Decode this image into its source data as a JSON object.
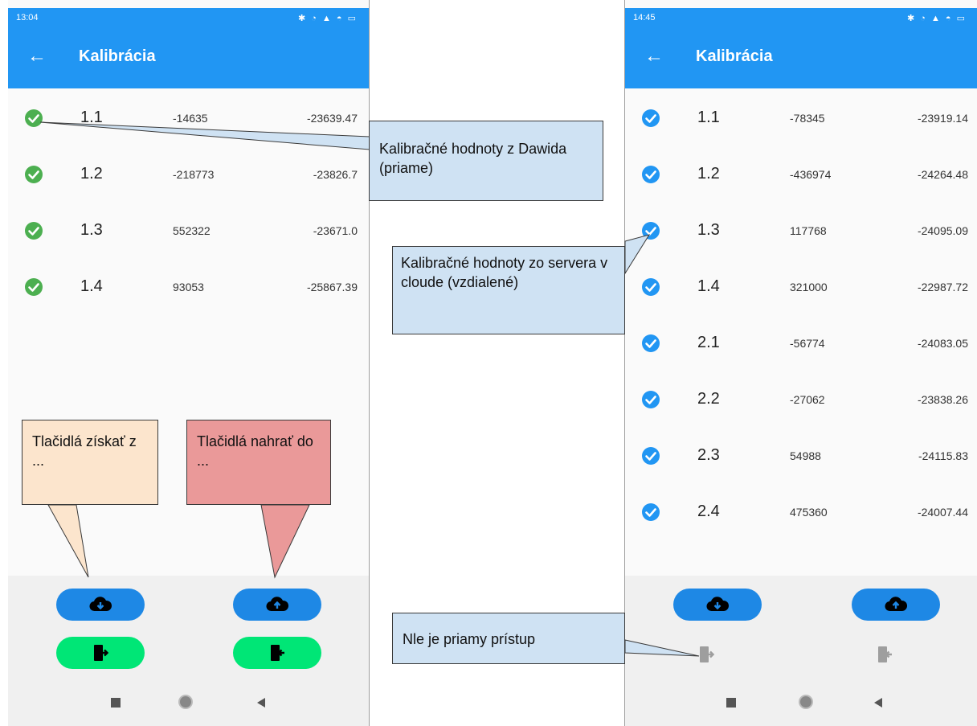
{
  "colors": {
    "primary": "#2196f3",
    "check_green": "#4caf50",
    "check_blue": "#2196f3",
    "download_pill": "#1e88e5",
    "device_pill": "#00e676",
    "disabled_icon": "#9e9e9e"
  },
  "left_phone": {
    "status_time": "13:04",
    "title": "Kalibrácia",
    "rows": [
      {
        "index": "1.1",
        "value1": "-14635",
        "value2": "-23639.47"
      },
      {
        "index": "1.2",
        "value1": "-218773",
        "value2": "-23826.7"
      },
      {
        "index": "1.3",
        "value1": "552322",
        "value2": "-23671.0"
      },
      {
        "index": "1.4",
        "value1": "93053",
        "value2": "-25867.39"
      }
    ]
  },
  "right_phone": {
    "status_time": "14:45",
    "title": "Kalibrácia",
    "rows": [
      {
        "index": "1.1",
        "value1": "-78345",
        "value2": "-23919.14"
      },
      {
        "index": "1.2",
        "value1": "-436974",
        "value2": "-24264.48"
      },
      {
        "index": "1.3",
        "value1": "117768",
        "value2": "-24095.09"
      },
      {
        "index": "1.4",
        "value1": "321000",
        "value2": "-22987.72"
      },
      {
        "index": "2.1",
        "value1": "-56774",
        "value2": "-24083.05"
      },
      {
        "index": "2.2",
        "value1": "-27062",
        "value2": "-23838.26"
      },
      {
        "index": "2.3",
        "value1": "54988",
        "value2": "-24115.83"
      },
      {
        "index": "2.4",
        "value1": "475360",
        "value2": "-24007.44"
      }
    ]
  },
  "annotations": {
    "direct_values": "Kalibračné hodnoty z Dawida (priame)",
    "cloud_values": "Kalibračné hodnoty zo servera v cloude (vzdialené)",
    "get_buttons": "Tlačidlá získať z ...",
    "upload_buttons": "Tlačidlá nahrať do ...",
    "no_direct_access": "Nle je priamy prístup"
  }
}
